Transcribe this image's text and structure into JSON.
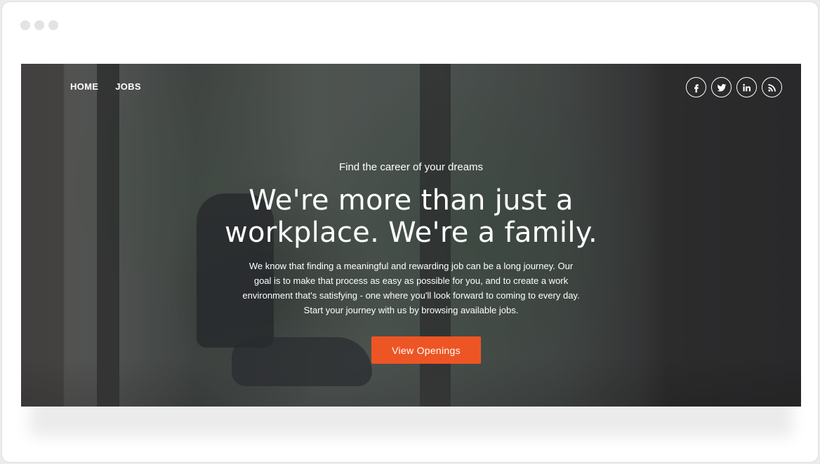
{
  "nav": {
    "items": [
      {
        "label": "HOME"
      },
      {
        "label": "JOBS"
      }
    ]
  },
  "social": {
    "icons": [
      "facebook-icon",
      "twitter-icon",
      "linkedin-icon",
      "rss-icon"
    ]
  },
  "hero": {
    "kicker": "Find the career of your dreams",
    "headline_line1": "We're more than just a",
    "headline_line2": "workplace. We're a family.",
    "body_line1": "We know that finding a meaningful and rewarding job can be a long journey. Our",
    "body_line2": "goal is to make that process as easy as possible for you, and to create a work",
    "body_line3": "environment that's satisfying - one where you'll look forward to coming to every day.",
    "body_line4": "Start your journey with us by browsing available jobs.",
    "cta_label": "View Openings"
  },
  "colors": {
    "accent": "#ee5524",
    "overlay": "#141418"
  }
}
